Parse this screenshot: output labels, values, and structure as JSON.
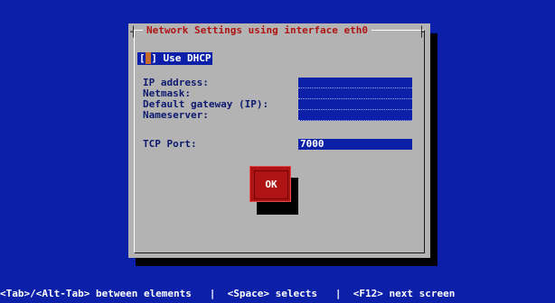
{
  "dialog": {
    "title": "Network Settings using interface eth0",
    "dhcp_checkbox_mark": " ",
    "dhcp_label": "Use DHCP",
    "fields": [
      {
        "label": "IP address:",
        "value": ""
      },
      {
        "label": "Netmask:",
        "value": ""
      },
      {
        "label": "Default gateway (IP):",
        "value": ""
      },
      {
        "label": "Nameserver:",
        "value": ""
      }
    ],
    "tcp_port_label": "TCP Port:",
    "tcp_port_value": "7000",
    "ok_label": "OK"
  },
  "footer": {
    "hint": "<Tab>/<Alt-Tab> between elements   |  <Space> selects   |  <F12> next screen"
  },
  "colors": {
    "background": "#0b1fa8",
    "dialog": "#b3b3b3",
    "title": "#b01313",
    "button": "#b01313"
  }
}
